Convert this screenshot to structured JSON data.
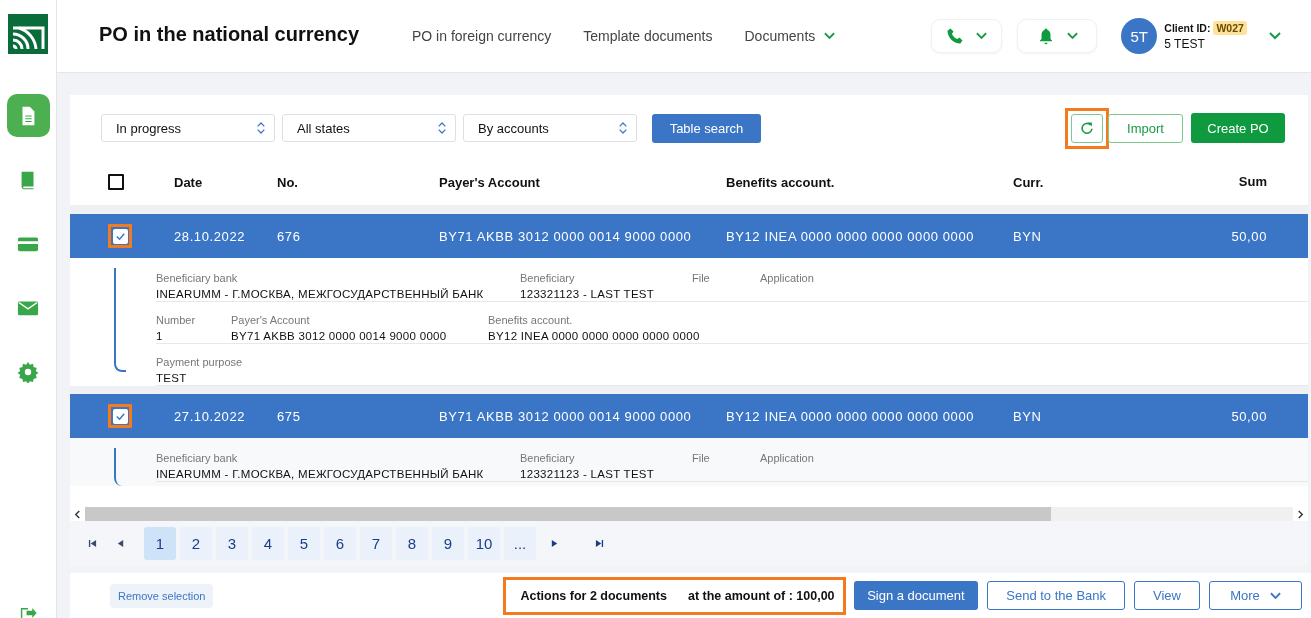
{
  "sidebar": {
    "items": [
      {
        "kind": "document",
        "selected": true
      },
      {
        "kind": "book",
        "selected": false
      },
      {
        "kind": "card",
        "selected": false
      },
      {
        "kind": "mail",
        "selected": false
      },
      {
        "kind": "settings",
        "selected": false
      }
    ]
  },
  "header": {
    "title": "PO in the national currency",
    "nav": [
      {
        "label": "PO in foreign currency",
        "dropdown": false
      },
      {
        "label": "Template documents",
        "dropdown": false
      },
      {
        "label": "Documents",
        "dropdown": true
      }
    ],
    "user": {
      "initials": "5T",
      "client_id_label": "Client ID:",
      "client_id": "W027",
      "name": "5 TEST"
    }
  },
  "toolbar": {
    "filters": [
      {
        "value": "In progress"
      },
      {
        "value": "All states"
      },
      {
        "value": "By accounts"
      }
    ],
    "search_button": "Table search",
    "refresh": {
      "highlighted": true
    },
    "import_button": "Import",
    "create_button": "Create PO"
  },
  "table": {
    "header_checkbox": {
      "checked": false
    },
    "columns": [
      "Date",
      "No.",
      "Payer's Account",
      "Benefits account.",
      "Curr.",
      "Sum"
    ],
    "rows": [
      {
        "selected": true,
        "highlighted": true,
        "cells": [
          "28.10.2022",
          "676",
          "BY71 AKBB 3012 0000 0014 9000 0000",
          "BY12 INEA 0000 0000 0000 0000 0000",
          "BYN",
          "50,00"
        ],
        "details": [
          [
            {
              "label": "Beneficiary bank",
              "value": "INEARUMM - Г.МОСКВА, МЕЖГОСУДАРСТВЕННЫЙ БАНК"
            },
            {
              "label": "Beneficiary",
              "value": "123321123 - LAST TEST"
            },
            {
              "label": "File"
            },
            {
              "label": "Application"
            }
          ],
          [
            {
              "label": "Number",
              "value": "1"
            },
            {
              "label": "Payer's Account",
              "value": "BY71 AKBB 3012 0000 0014 9000 0000"
            },
            {
              "label": "Benefits account.",
              "value": "BY12 INEA 0000 0000 0000 0000 0000"
            }
          ],
          [
            {
              "label": "Payment purpose",
              "value": "TEST"
            }
          ]
        ]
      },
      {
        "selected": true,
        "highlighted": true,
        "cells": [
          "27.10.2022",
          "675",
          "BY71 AKBB 3012 0000 0014 9000 0000",
          "BY12 INEA 0000 0000 0000 0000 0000",
          "BYN",
          "50,00"
        ],
        "details": [
          [
            {
              "label": "Beneficiary bank",
              "value": "INEARUMM - Г.МОСКВА, МЕЖГОСУДАРСТВЕННЫЙ БАНК"
            },
            {
              "label": "Beneficiary",
              "value": "123321123 - LAST TEST"
            },
            {
              "label": "File"
            },
            {
              "label": "Application"
            }
          ]
        ]
      }
    ]
  },
  "pagination": {
    "pages": [
      {
        "label": "1",
        "selected": true
      },
      {
        "label": "2",
        "selected": false
      },
      {
        "label": "3",
        "selected": false
      },
      {
        "label": "4",
        "selected": false
      },
      {
        "label": "5",
        "selected": false
      },
      {
        "label": "6",
        "selected": false
      },
      {
        "label": "7",
        "selected": false
      },
      {
        "label": "8",
        "selected": false
      },
      {
        "label": "9",
        "selected": false
      },
      {
        "label": "10",
        "selected": false
      },
      {
        "label": "...",
        "selected": false
      }
    ]
  },
  "footer": {
    "remove_selection": "Remove selection",
    "summary": {
      "highlighted": true,
      "count_text": "Actions for 2 documents",
      "amount_text": "at the amount of : 100,00"
    },
    "buttons": [
      {
        "label": "Sign a document",
        "kind": "primary"
      },
      {
        "label": "Send to the Bank",
        "kind": "outline"
      },
      {
        "label": "View",
        "kind": "outline"
      },
      {
        "label": "More",
        "kind": "dropdown"
      }
    ]
  }
}
